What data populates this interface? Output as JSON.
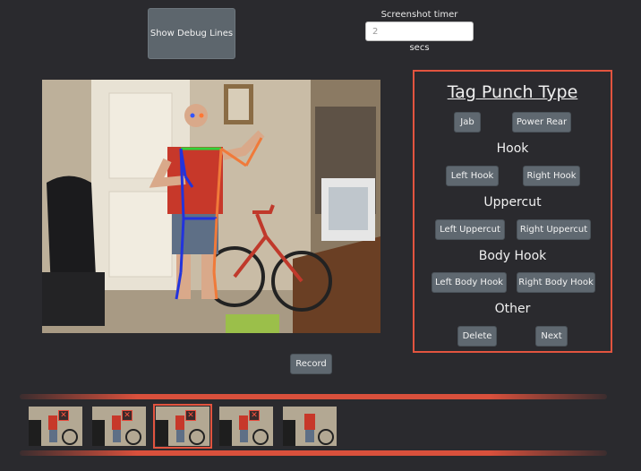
{
  "header": {
    "debug_button": "Show Debug Lines",
    "timer_label": "Screenshot timer",
    "timer_value": "2",
    "timer_unit": "secs"
  },
  "record_button": "Record",
  "tag_panel": {
    "title": "Tag Punch Type",
    "top_buttons": [
      "Jab",
      "Power Rear"
    ],
    "hook": {
      "title": "Hook",
      "buttons": [
        "Left Hook",
        "Right Hook"
      ]
    },
    "uppercut": {
      "title": "Uppercut",
      "buttons": [
        "Left Uppercut",
        "Right Uppercut"
      ]
    },
    "body_hook": {
      "title": "Body Hook",
      "buttons": [
        "Left Body Hook",
        "Right Body Hook"
      ]
    },
    "other": {
      "title": "Other",
      "buttons": [
        "Delete",
        "Next"
      ]
    }
  },
  "filmstrip": {
    "selected_index": 2,
    "thumbnail_count": 5
  },
  "colors": {
    "background": "#2a2a2e",
    "accent": "#e2543f",
    "button": "#5f6870"
  }
}
